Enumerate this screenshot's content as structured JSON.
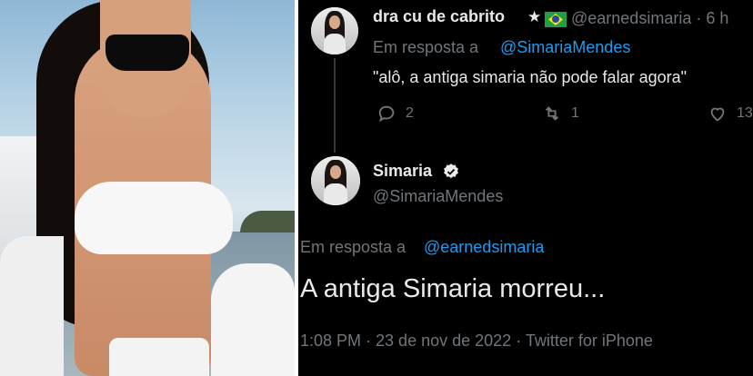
{
  "tweet_reply": {
    "display_name": "dra cu de cabrito",
    "star_glyph": "★",
    "flag_icon": "brazil-flag-icon",
    "handle": "@earnedsimaria",
    "time": "· 6 h",
    "reply_prefix": "Em resposta a",
    "reply_to": "@SimariaMendes",
    "text": "\"alô, a antiga simaria não pode falar agora\"",
    "reply_count": "2",
    "retweet_count": "1",
    "like_count": "13"
  },
  "tweet_main": {
    "display_name": "Simaria",
    "verified_icon": "verified-badge-icon",
    "handle": "@SimariaMendes",
    "reply_prefix": "Em resposta a",
    "reply_to": "@earnedsimaria",
    "text": "A antiga Simaria morreu...",
    "meta": "1:08 PM · 23 de nov de 2022 · Twitter for iPhone"
  },
  "colors": {
    "background": "#000000",
    "text_primary": "#e7e9ea",
    "text_secondary": "#71767b",
    "link": "#1d9bf0"
  }
}
